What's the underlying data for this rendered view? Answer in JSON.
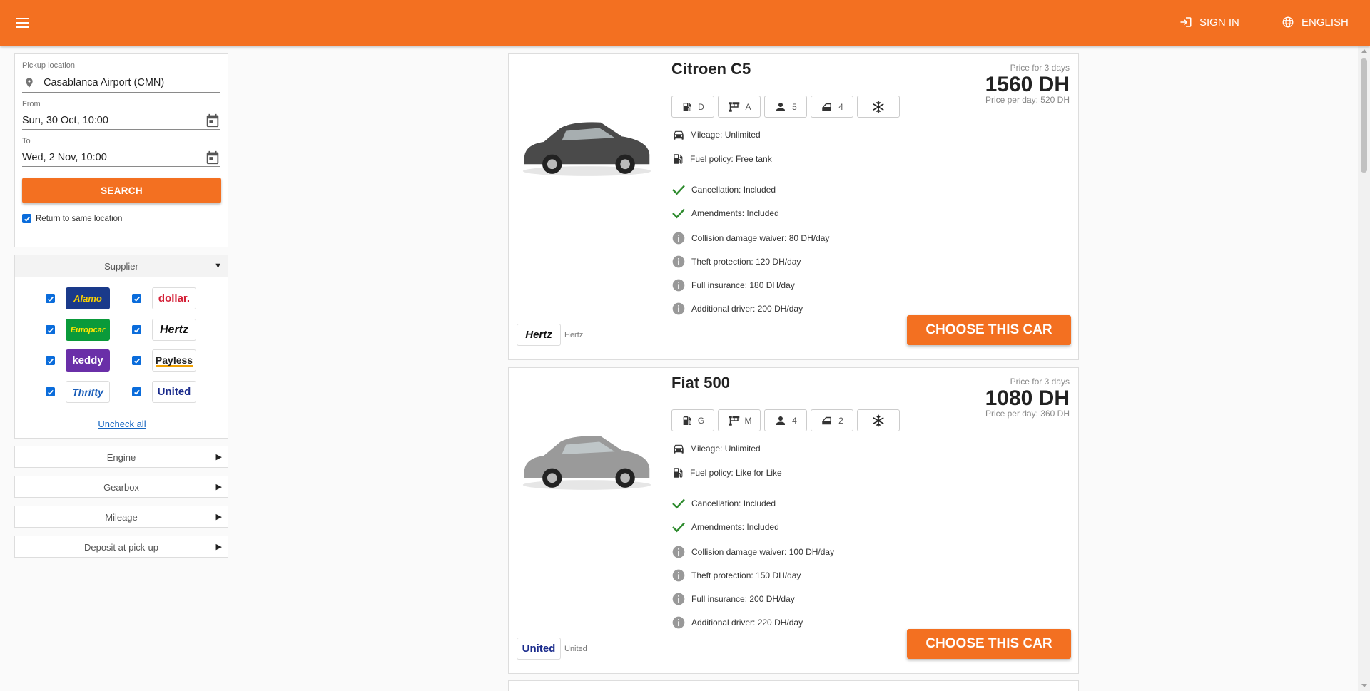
{
  "header": {
    "sign_in": "SIGN IN",
    "language": "ENGLISH"
  },
  "search": {
    "pickup_label": "Pickup location",
    "pickup_value": "Casablanca Airport (CMN)",
    "from_label": "From",
    "from_value": "Sun, 30 Oct, 10:00",
    "to_label": "To",
    "to_value": "Wed, 2 Nov, 10:00",
    "search_button": "SEARCH",
    "return_same_label": "Return to same location",
    "return_same_checked": true
  },
  "filters": {
    "supplier_title": "Supplier",
    "suppliers": [
      {
        "name": "Alamo",
        "checked": true
      },
      {
        "name": "dollar.",
        "checked": true
      },
      {
        "name": "Europcar",
        "checked": true
      },
      {
        "name": "Hertz",
        "checked": true
      },
      {
        "name": "keddy",
        "checked": true
      },
      {
        "name": "Payless",
        "checked": true
      },
      {
        "name": "Thrifty",
        "checked": true
      },
      {
        "name": "United",
        "checked": true
      }
    ],
    "uncheck_all": "Uncheck all",
    "engine": "Engine",
    "gearbox": "Gearbox",
    "mileage": "Mileage",
    "deposit": "Deposit at pick-up"
  },
  "cars": [
    {
      "name": "Citroen C5",
      "price_label": "Price for 3 days",
      "price_total": "1560 DH",
      "price_per_day": "Price per day: 520 DH",
      "specs": {
        "fuel": "D",
        "gearbox": "A",
        "seats": "5",
        "doors": "4"
      },
      "mileage": "Mileage: Unlimited",
      "fuel_policy": "Fuel policy: Free tank",
      "cancellation": "Cancellation: Included",
      "amendments": "Amendments: Included",
      "cdw": "Collision damage waiver: 80 DH/day",
      "theft": "Theft protection: 120 DH/day",
      "insurance": "Full insurance: 180 DH/day",
      "driver": "Additional driver: 200 DH/day",
      "supplier": "Hertz",
      "supplier_logo": "Hertz",
      "choose": "CHOOSE THIS CAR",
      "car_color": "#4a4a4a"
    },
    {
      "name": "Fiat 500",
      "price_label": "Price for 3 days",
      "price_total": "1080 DH",
      "price_per_day": "Price per day: 360 DH",
      "specs": {
        "fuel": "G",
        "gearbox": "M",
        "seats": "4",
        "doors": "2"
      },
      "mileage": "Mileage: Unlimited",
      "fuel_policy": "Fuel policy: Like for Like",
      "cancellation": "Cancellation: Included",
      "amendments": "Amendments: Included",
      "cdw": "Collision damage waiver: 100 DH/day",
      "theft": "Theft protection: 150 DH/day",
      "insurance": "Full insurance: 200 DH/day",
      "driver": "Additional driver: 220 DH/day",
      "supplier": "United",
      "supplier_logo": "United",
      "choose": "CHOOSE THIS CAR",
      "car_color": "#9a9a9a"
    }
  ],
  "colors": {
    "brand": "#f37021",
    "check": "#2e8b2e",
    "info": "#999999",
    "link": "#1565c0"
  }
}
